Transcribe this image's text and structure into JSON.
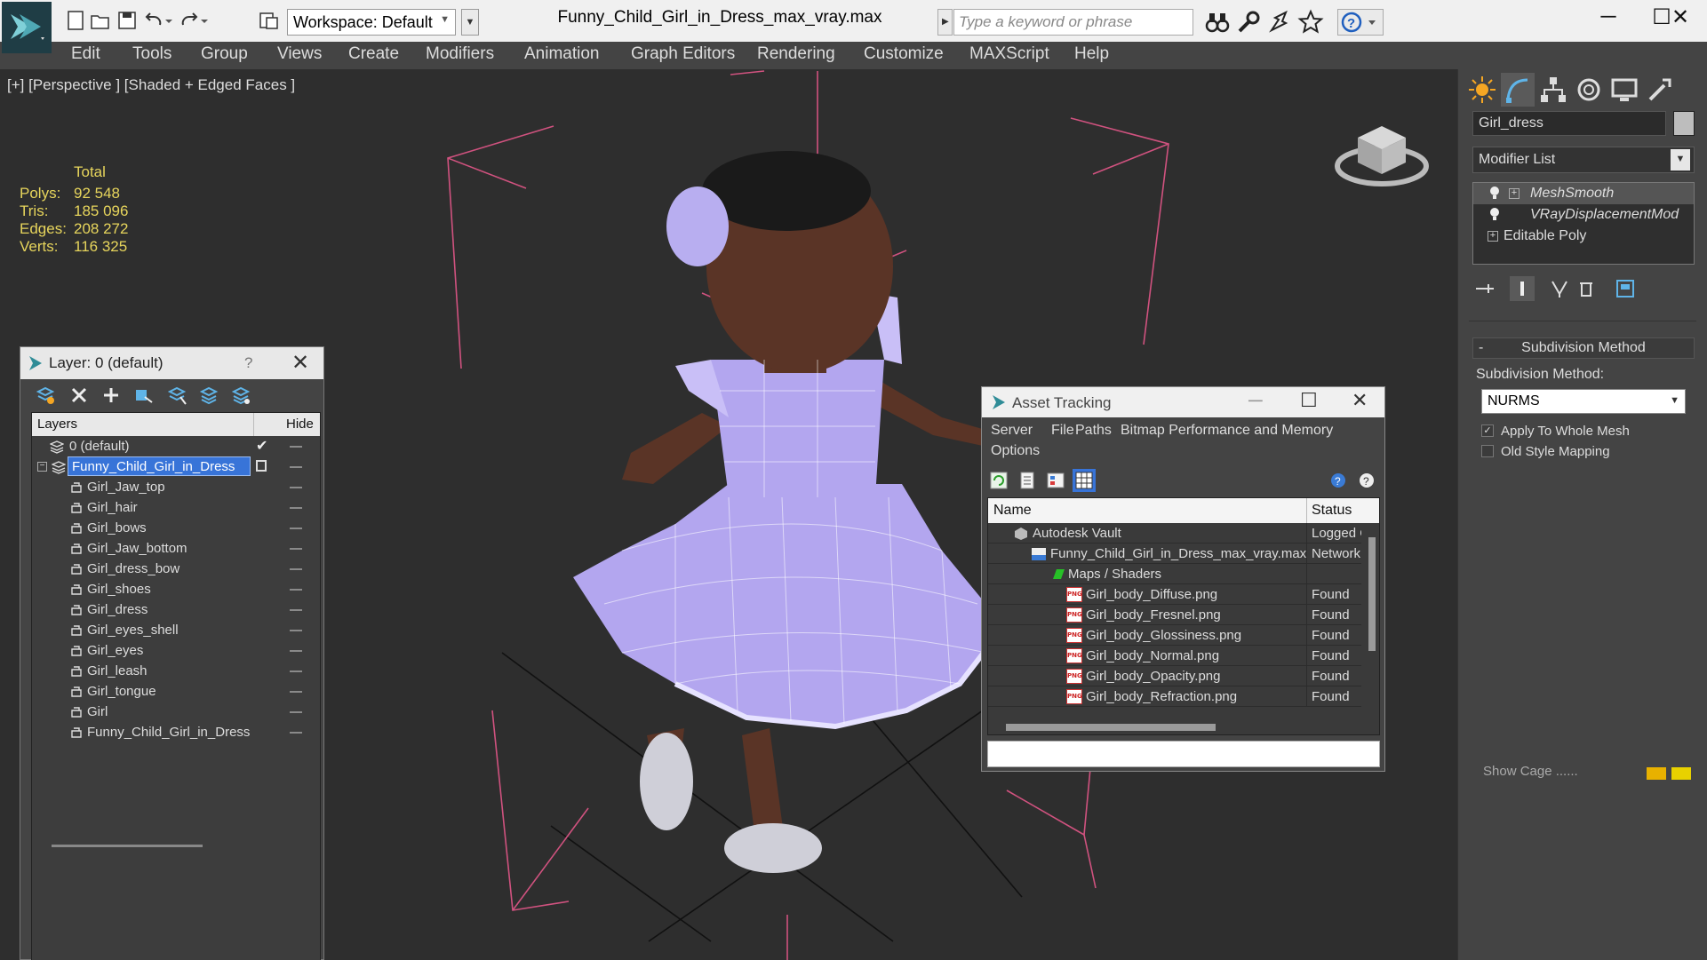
{
  "titlebar": {
    "workspace": "Workspace: Default",
    "title": "Funny_Child_Girl_in_Dress_max_vray.max",
    "search_placeholder": "Type a keyword or phrase",
    "minimize": "─",
    "maximize": "☐",
    "close": "✕"
  },
  "menu": [
    "Edit",
    "Tools",
    "Group",
    "Views",
    "Create",
    "Modifiers",
    "Animation",
    "Graph Editors",
    "Rendering",
    "Customize",
    "MAXScript",
    "Help"
  ],
  "viewport": {
    "label": "[+] [Perspective ] [Shaded + Edged Faces ]",
    "stats_header": "Total",
    "stats": [
      {
        "label": "Polys:",
        "value": "92 548"
      },
      {
        "label": "Tris:",
        "value": "185 096"
      },
      {
        "label": "Edges:",
        "value": "208 272"
      },
      {
        "label": "Verts:",
        "value": "116 325"
      }
    ]
  },
  "command_panel": {
    "object_name": "Girl_dress",
    "modifier_list": "Modifier List",
    "stack": [
      {
        "label": "MeshSmooth"
      },
      {
        "label": "VRayDisplacementMod"
      },
      {
        "label": "Editable Poly"
      }
    ],
    "rollout_toggle": "-",
    "rollout_title": "Subdivision Method",
    "subdiv_label": "Subdivision Method:",
    "subdiv_value": "NURMS",
    "checks": [
      {
        "label": "Apply To Whole Mesh",
        "checked": true
      },
      {
        "label": "Old Style Mapping",
        "checked": false
      }
    ],
    "show_cage": "Show Cage ......"
  },
  "layer_explorer": {
    "title": "Layer: 0 (default)",
    "help": "?",
    "close": "✕",
    "col_layers": "Layers",
    "col_hide": "Hide",
    "rows": [
      {
        "name": "0 (default)",
        "level": 0,
        "type": "layer"
      },
      {
        "name": "Funny_Child_Girl_in_Dress",
        "level": 0,
        "type": "layer",
        "selected": true
      },
      {
        "name": "Girl_Jaw_top",
        "level": 1,
        "type": "object"
      },
      {
        "name": "Girl_hair",
        "level": 1,
        "type": "object"
      },
      {
        "name": "Girl_bows",
        "level": 1,
        "type": "object"
      },
      {
        "name": "Girl_Jaw_bottom",
        "level": 1,
        "type": "object"
      },
      {
        "name": "Girl_dress_bow",
        "level": 1,
        "type": "object"
      },
      {
        "name": "Girl_shoes",
        "level": 1,
        "type": "object"
      },
      {
        "name": "Girl_dress",
        "level": 1,
        "type": "object"
      },
      {
        "name": "Girl_eyes_shell",
        "level": 1,
        "type": "object"
      },
      {
        "name": "Girl_eyes",
        "level": 1,
        "type": "object"
      },
      {
        "name": "Girl_leash",
        "level": 1,
        "type": "object"
      },
      {
        "name": "Girl_tongue",
        "level": 1,
        "type": "object"
      },
      {
        "name": "Girl",
        "level": 1,
        "type": "object"
      },
      {
        "name": "Funny_Child_Girl_in_Dress",
        "level": 1,
        "type": "object"
      }
    ]
  },
  "asset_tracking": {
    "title": "Asset Tracking",
    "minimize": "─",
    "maximize": "☐",
    "close": "✕",
    "menu": [
      "Server",
      "File",
      "Paths",
      "Bitmap Performance and Memory",
      "Options"
    ],
    "col_name": "Name",
    "col_status": "Status",
    "rows": [
      {
        "name": "Autodesk Vault",
        "status": "Logged O",
        "level": 1,
        "icon": "vault"
      },
      {
        "name": "Funny_Child_Girl_in_Dress_max_vray.max",
        "status": "Network",
        "level": 2,
        "icon": "max"
      },
      {
        "name": "Maps / Shaders",
        "status": "",
        "level": 3,
        "icon": "maps"
      },
      {
        "name": "Girl_body_Diffuse.png",
        "status": "Found",
        "level": 4,
        "icon": "png"
      },
      {
        "name": "Girl_body_Fresnel.png",
        "status": "Found",
        "level": 4,
        "icon": "png"
      },
      {
        "name": "Girl_body_Glossiness.png",
        "status": "Found",
        "level": 4,
        "icon": "png"
      },
      {
        "name": "Girl_body_Normal.png",
        "status": "Found",
        "level": 4,
        "icon": "png"
      },
      {
        "name": "Girl_body_Opacity.png",
        "status": "Found",
        "level": 4,
        "icon": "png"
      },
      {
        "name": "Girl_body_Refraction.png",
        "status": "Found",
        "level": 4,
        "icon": "png"
      }
    ],
    "png_badge": "PNG"
  },
  "colors": {
    "viewport_bg": "#2e2e2e",
    "stats_text": "#e7d55c",
    "selection": "#3874d8",
    "dress": "#b3a6ef",
    "skin": "#5a3426",
    "grid_line": "#111111",
    "light_frame": "#d0527f"
  }
}
